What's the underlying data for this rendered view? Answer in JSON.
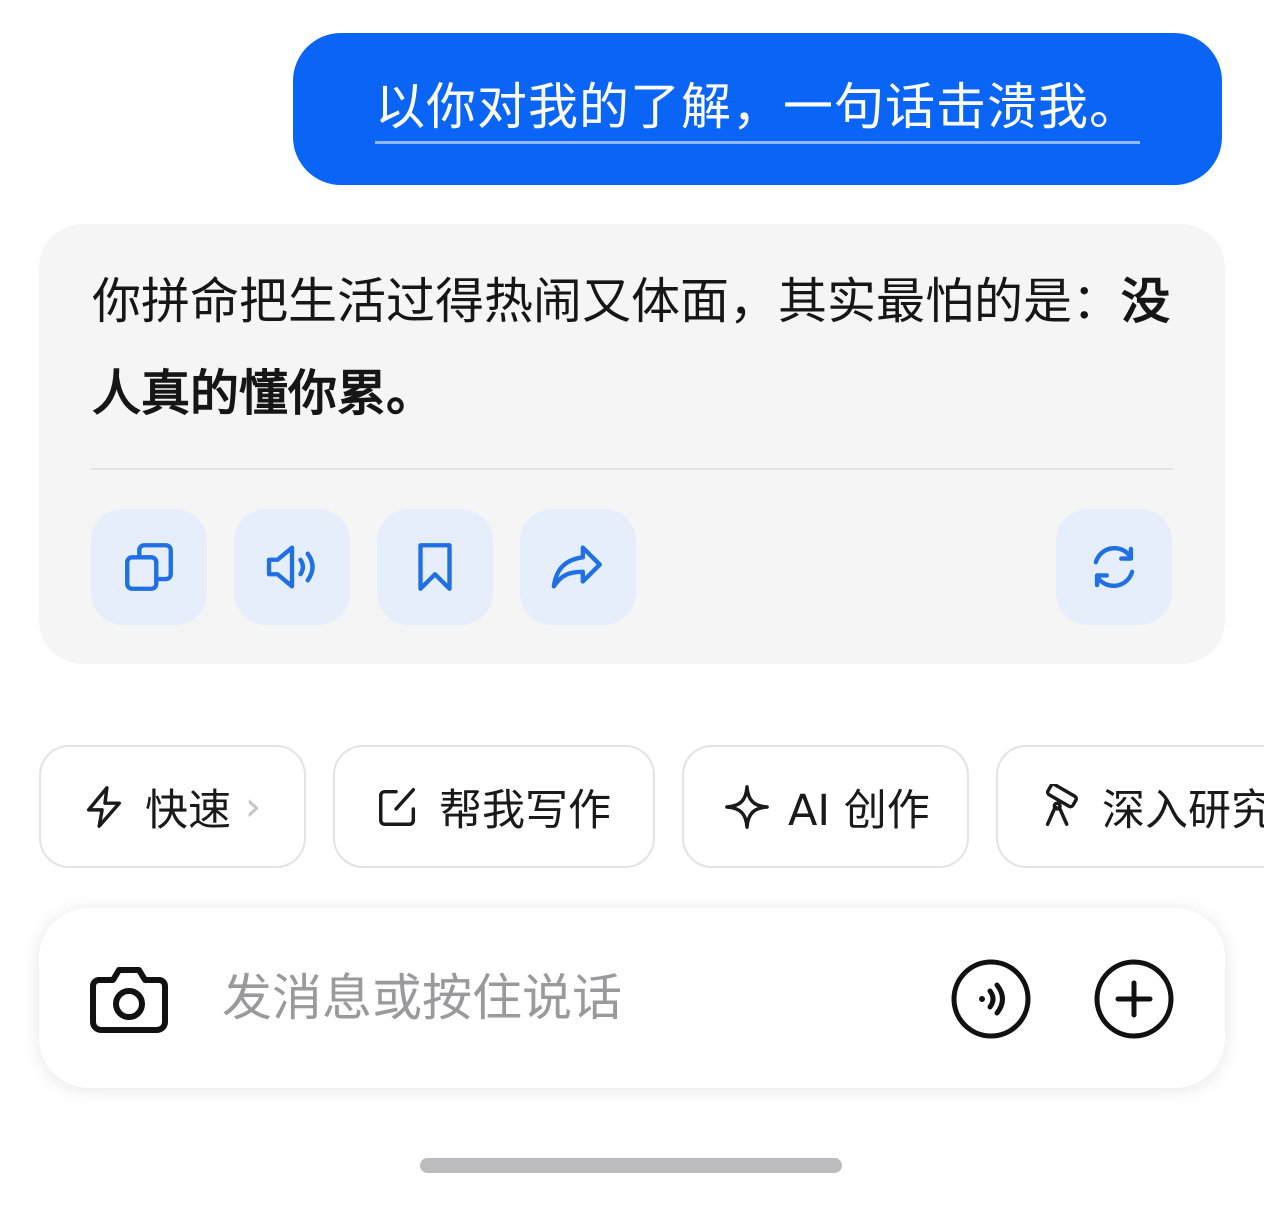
{
  "user_message": {
    "text": "以你对我的了解，一句话击溃我。"
  },
  "reply": {
    "text_plain": "你拼命把生活过得热闹又体面，其实最怕的是：",
    "text_bold": "没人真的懂你累。",
    "actions": [
      {
        "id": "copy",
        "icon": "copy-icon"
      },
      {
        "id": "read-aloud",
        "icon": "speaker-icon"
      },
      {
        "id": "bookmark",
        "icon": "bookmark-icon"
      },
      {
        "id": "share",
        "icon": "share-icon"
      },
      {
        "id": "regenerate",
        "icon": "refresh-icon"
      }
    ]
  },
  "chips": [
    {
      "label": "快速",
      "icon": "lightning-icon",
      "has_chevron": true
    },
    {
      "label": "帮我写作",
      "icon": "edit-icon"
    },
    {
      "label": "AI 创作",
      "icon": "sparkle-icon"
    },
    {
      "label": "深入研究",
      "icon": "telescope-icon"
    }
  ],
  "input": {
    "placeholder": "发消息或按住说话"
  },
  "colors": {
    "accent": "#0a65f6",
    "action_icon": "#1f6fe5",
    "action_bg": "#e6eefb",
    "card_bg": "#f5f5f6"
  }
}
